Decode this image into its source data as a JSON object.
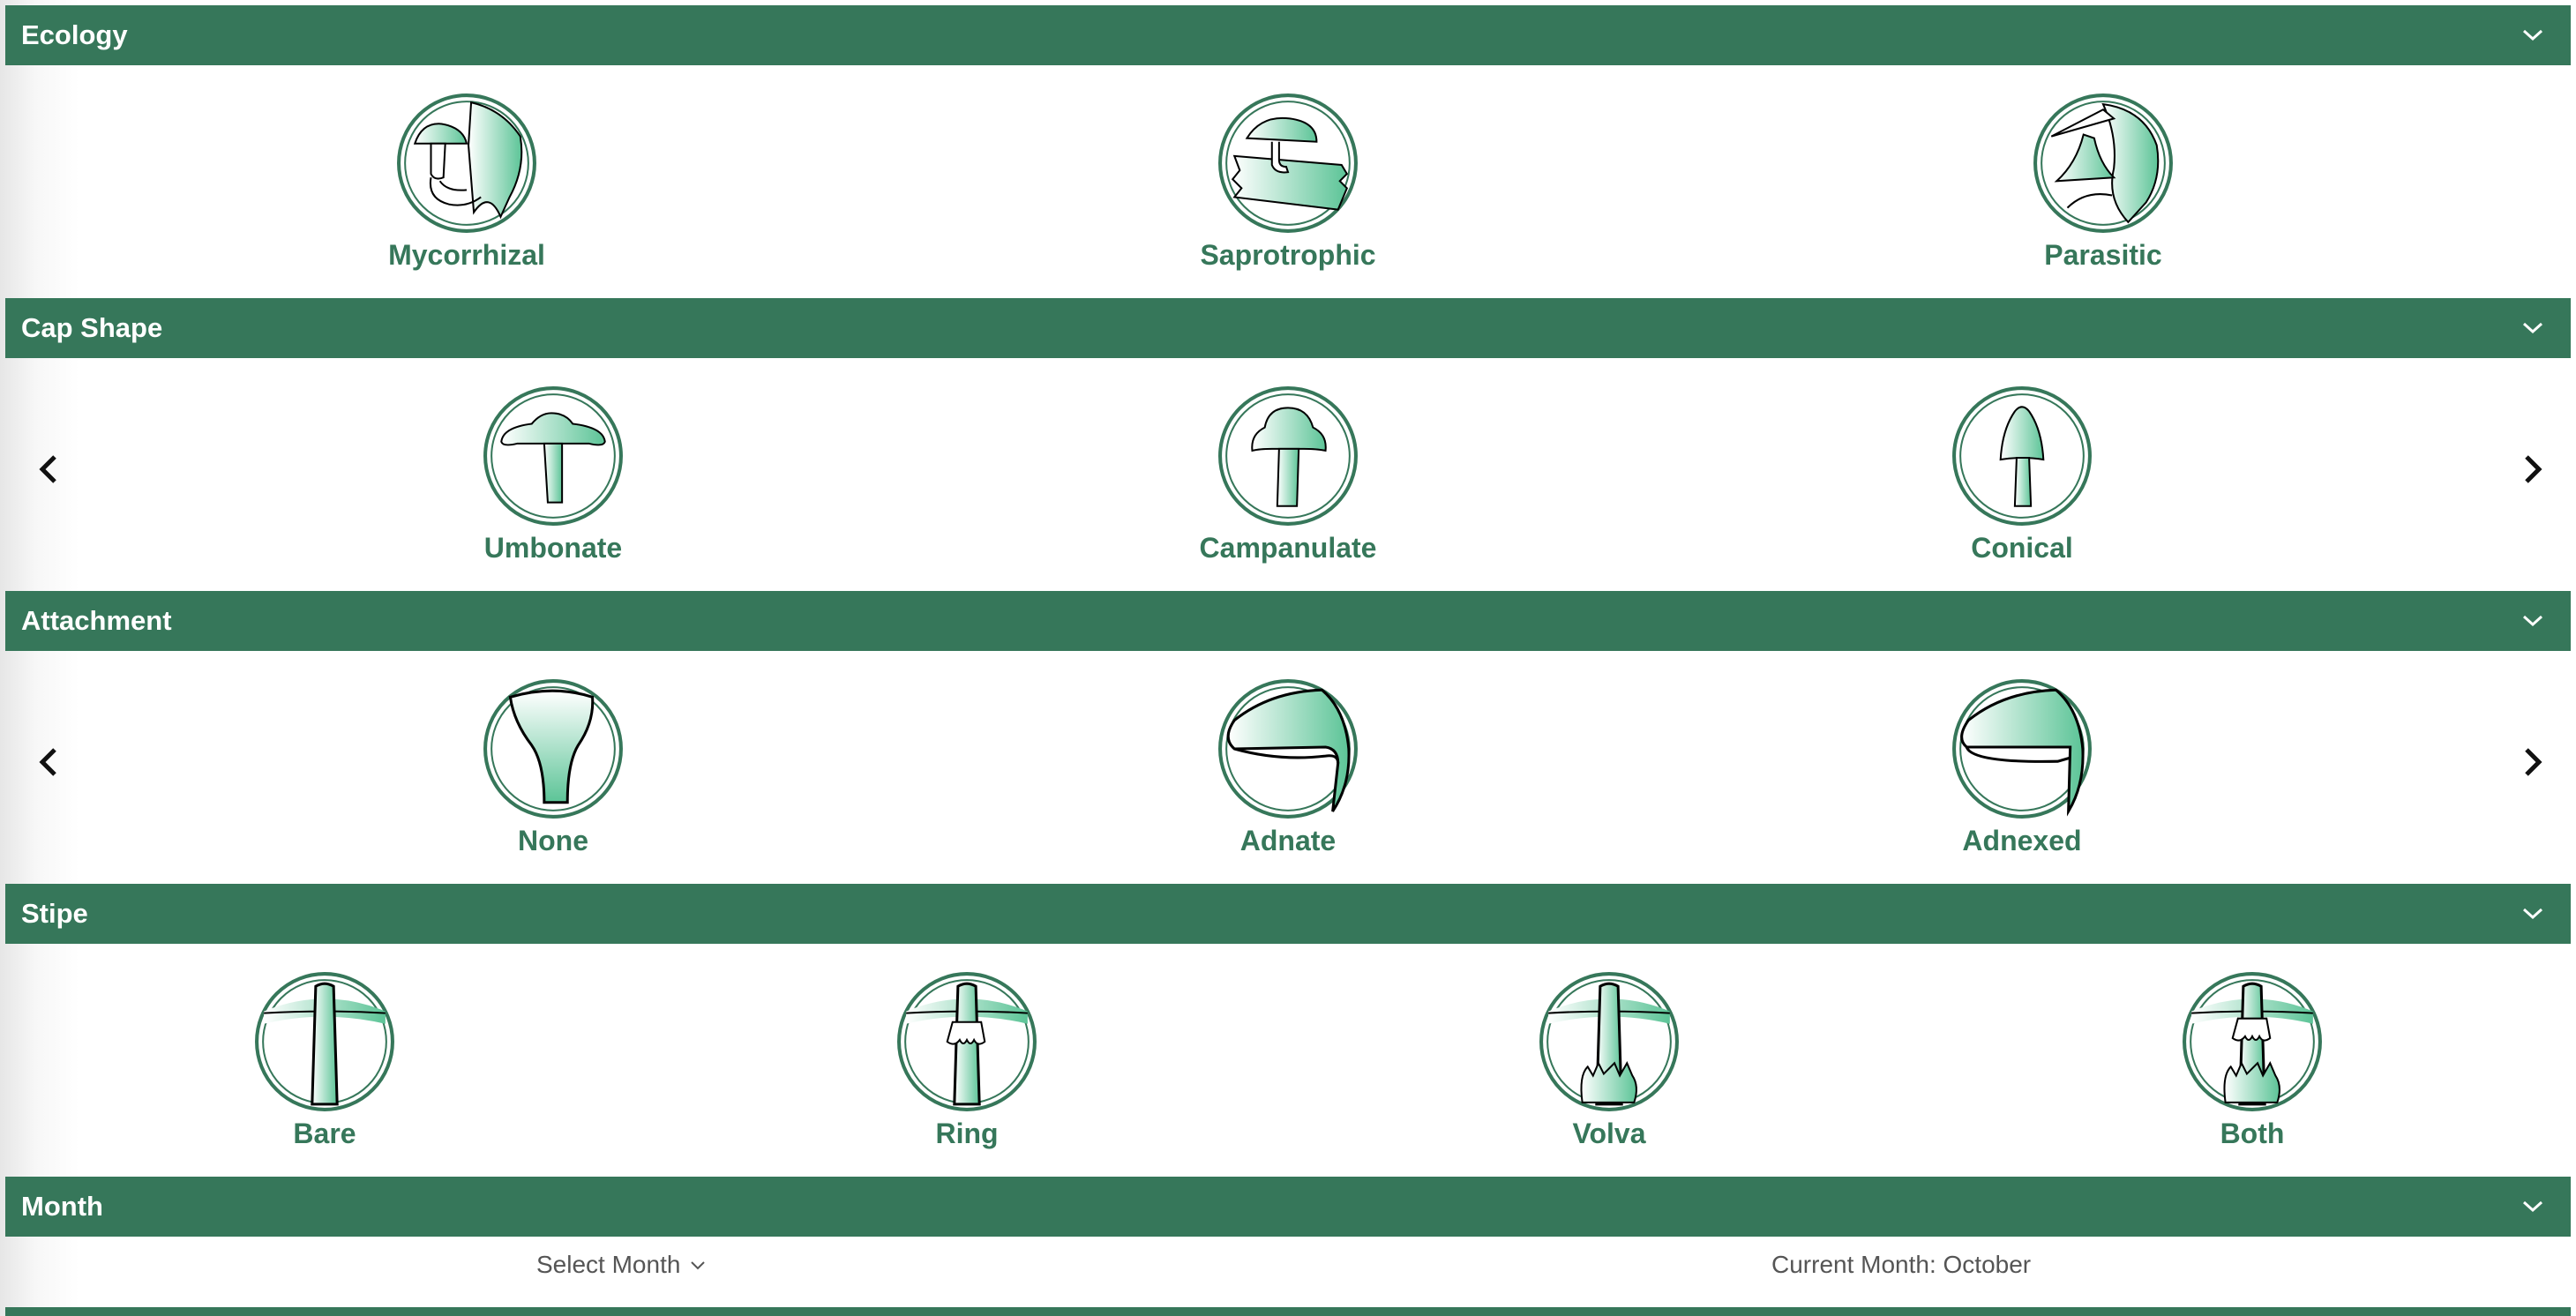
{
  "sections": {
    "ecology": {
      "title": "Ecology",
      "items": [
        "Mycorrhizal",
        "Saprotrophic",
        "Parasitic"
      ]
    },
    "cap_shape": {
      "title": "Cap Shape",
      "items": [
        "Umbonate",
        "Campanulate",
        "Conical"
      ]
    },
    "attachment": {
      "title": "Attachment",
      "items": [
        "None",
        "Adnate",
        "Adnexed"
      ]
    },
    "stipe": {
      "title": "Stipe",
      "items": [
        "Bare",
        "Ring",
        "Volva",
        "Both"
      ]
    },
    "month": {
      "title": "Month",
      "select_label": "Select Month",
      "current_month": "Current Month: October"
    }
  },
  "icons": {
    "section_toggle": "chevron-down-icon",
    "prev": "chevron-left-icon",
    "next": "chevron-right-icon",
    "ecology": [
      "mycorrhizal-icon",
      "saprotrophic-icon",
      "parasitic-icon"
    ],
    "cap_shape": [
      "umbonate-icon",
      "campanulate-icon",
      "conical-icon"
    ],
    "attachment": [
      "gill-none-icon",
      "gill-adnate-icon",
      "gill-adnexed-icon"
    ],
    "stipe": [
      "stipe-bare-icon",
      "stipe-ring-icon",
      "stipe-volva-icon",
      "stipe-both-icon"
    ]
  },
  "colors": {
    "header_bg": "#36775a",
    "header_text": "#ffffff",
    "accent": "#36775a",
    "icon_fill": "#5cc497",
    "muted_text": "#555555"
  }
}
